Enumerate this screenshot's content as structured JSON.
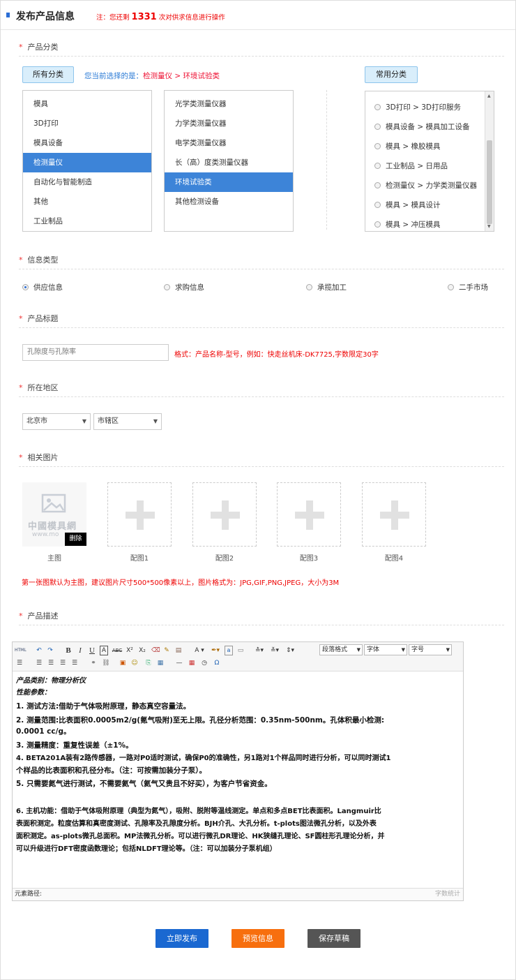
{
  "header": {
    "title": "发布产品信息",
    "note_prefix": "注：您还剩",
    "remaining": "1331",
    "note_suffix": "次对供求信息进行操作"
  },
  "sections": {
    "category": "产品分类",
    "info_type": "信息类型",
    "title": "产品标题",
    "region": "所在地区",
    "images": "相关图片",
    "description": "产品描述"
  },
  "category": {
    "all_btn": "所有分类",
    "current_label": "您当前选择的是：",
    "current_value": "检测量仪 > 环境试验类",
    "common_btn": "常用分类",
    "level1": [
      "模具",
      "3D打印",
      "模具设备",
      "检测量仪",
      "自动化与智能制造",
      "其他",
      "工业制品"
    ],
    "level2": [
      "光学类测量仪器",
      "力学类测量仪器",
      "电学类测量仪器",
      "长（高）度类测量仪器",
      "环境试验类",
      "其他检测设备"
    ],
    "frequent": [
      "3D打印 > 3D打印服务",
      "模具设备 > 模具加工设备",
      "模具 > 橡胶模具",
      "工业制品 > 日用品",
      "检测量仪 > 力学类测量仪器",
      "模具 > 模具设计",
      "模具 > 冲压模具"
    ]
  },
  "info_type": {
    "options": [
      "供应信息",
      "求购信息",
      "承揽加工",
      "二手市场"
    ],
    "selected": "供应信息"
  },
  "title_field": {
    "value": "孔隙度与孔隙率",
    "hint": "格式：产品名称-型号，例如：快走丝机床-DK7725,字数限定30字"
  },
  "region": {
    "city": "北京市",
    "district": "市辖区"
  },
  "images": {
    "captions": [
      "主图",
      "配图1",
      "配图2",
      "配图3",
      "配图4"
    ],
    "watermark": "中國模具網",
    "watermark_url": "www.mo",
    "delete": "删除",
    "note": "第一张图默认为主图，建议图片尺寸500*500像素以上，图片格式为：JPG,GIF,PNG,JPEG，大小为3M"
  },
  "editor": {
    "paragraph_format": "段落格式",
    "font": "字体",
    "font_size": "字号",
    "path_label": "元素路径:",
    "word_count": "字数统计",
    "lines": [
      "产品类别：物理分析仪",
      "性能参数：",
      "1. 测试方法:借助于气体吸附原理，静态真空容量法。",
      "2. 测量范围:比表面积0.0005m2/g(氪气吸附)至无上限。孔径分析范围：0.35nm-500nm。孔体积最小检测:",
      "0.0001 cc/g。",
      "3. 测量精度：重复性误差（±1%。",
      "4. BETA201A装有2路传感器，一路对P0适时测试，确保P0的准确性，另1路对1个样品同时进行分析，可以同时测试1",
      "个样品的比表面积和孔径分布。（注：可按需加装分子泵）。",
      "5. 只需要氮气进行测试，不需要氦气（氦气又贵且不好买），为客户节省资金。",
      "6. 主机功能：借助于气体吸附原理（典型为氮气），吸附、脱附等温线测定。单点和多点BET比表面积。Langmuir比",
      "表面积测定。粒度估算和真密度测试、孔隙率及孔隙度分析。BJH介孔、大孔分析。t-plots图法微孔分析，以及外表",
      "面积测定。as-plots微孔总面积。MP法微孔分析。可以进行微孔DR理论、HK狭缝孔理论、SF圆柱形孔理论分析，并",
      "可以升级进行DFT密度函数理论；包括NLDFT理论等。（注：可以加装分子泵机组）"
    ]
  },
  "buttons": {
    "publish": "立即发布",
    "preview": "预览信息",
    "draft": "保存草稿"
  },
  "colors": {
    "primary": "#1a68d1",
    "orange": "#f76f0e",
    "gray": "#555555",
    "accent_red": "#ee0000"
  }
}
